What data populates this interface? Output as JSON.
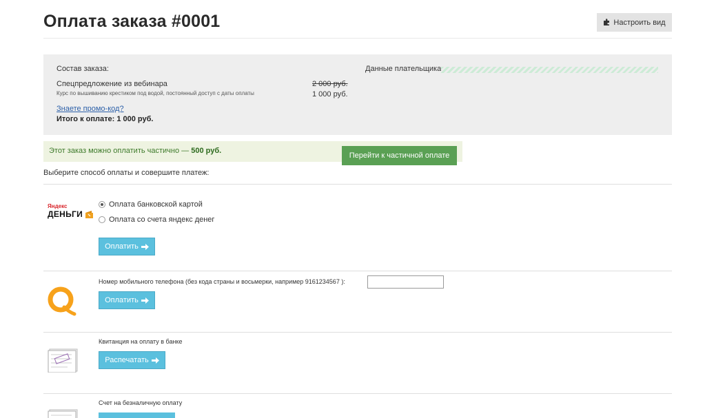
{
  "header": {
    "title": "Оплата заказа #0001",
    "configure_label": "Настроить вид"
  },
  "summary": {
    "composition_label": "Состав заказа:",
    "payer_label": "Данные плательщика:",
    "item_title": "Спецпредложение из вебинара",
    "item_description": "Курс по вышиванию крестиком под водой, постоянный доступ с даты оплаты",
    "old_price": "2 000 руб.",
    "new_price": "1 000 руб.",
    "promo_link": "Знаете промо-код?",
    "total": "Итого к оплате: 1 000 руб."
  },
  "partial": {
    "text": "Этот заказ можно оплатить частично —",
    "amount": "500 руб.",
    "button_label": "Перейти к частичной оплате"
  },
  "choose_text": "Выберите способ оплаты и совершите платеж:",
  "methods": {
    "yandex": {
      "logo_top": "Яндекс",
      "logo_bottom": "ДЕНЬГИ",
      "option_card": "Оплата банковской картой",
      "option_wallet": "Оплата со счета яндекс денег",
      "button_label": "Оплатить"
    },
    "qiwi": {
      "phone_label": "Номер мобильного телефона (без кода страны и восьмерки, например 9161234567 ):",
      "phone_value": "",
      "button_label": "Оплатить"
    },
    "bank_receipt": {
      "label": "Квитанция на оплату в банке",
      "button_label": "Распечатать"
    },
    "invoice": {
      "label": "Счет на безналичную оплату"
    }
  },
  "colors": {
    "pay_button": "#5bc0de",
    "partial_button": "#5aa054",
    "link": "#2b5fa8"
  }
}
